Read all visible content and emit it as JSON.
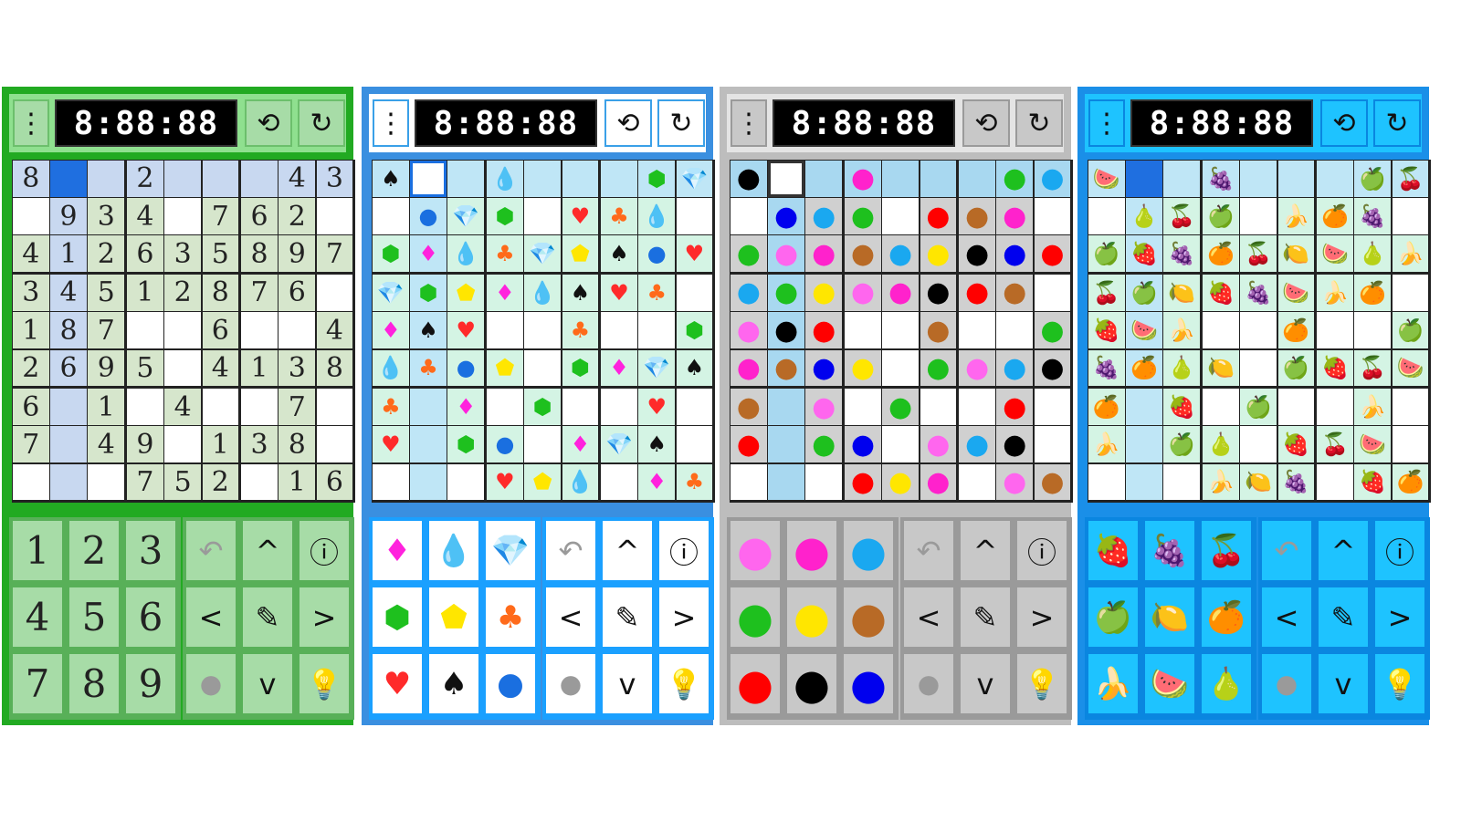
{
  "panels": [
    {
      "theme": "numbers",
      "frame": "#22aa22",
      "top_bg": "#8fe08f",
      "btn_bg": "#a7dca7",
      "btn_border": "#6cbf6c",
      "cell_bg": "#ffffff",
      "cell_tint": "#d6e6cc",
      "cell_row": "#c8d8f0",
      "cell_sel": "#1f6fe0",
      "pad_bg": "#a7dca7",
      "pad_border": "#58b058",
      "timer": "8:88:88",
      "keypad": [
        "1",
        "2",
        "3",
        "4",
        "5",
        "6",
        "7",
        "8",
        "9"
      ]
    },
    {
      "theme": "symbols",
      "frame": "#3a8fe0",
      "top_bg": "#ffffff",
      "btn_bg": "#ffffff",
      "btn_border": "#3aa0e8",
      "cell_bg": "#ffffff",
      "cell_tint": "#d4f4e4",
      "cell_row": "#bfe6f6",
      "cell_sel": "#ffffff",
      "pad_bg": "#ffffff",
      "pad_border": "#1aa0ff",
      "timer": "8:88:88",
      "keypad": [
        "♦",
        "💧",
        "💎",
        "⬢",
        "⬟",
        "♣",
        "♥",
        "♠",
        "●"
      ]
    },
    {
      "theme": "colors",
      "frame": "#bdbdbd",
      "top_bg": "#e4e4e4",
      "btn_bg": "#c8c8c8",
      "btn_border": "#9a9a9a",
      "cell_bg": "#ffffff",
      "cell_tint": "#d0d0d0",
      "cell_row": "#a8d8f0",
      "cell_sel": "#ffffff",
      "pad_bg": "#c8c8c8",
      "pad_border": "#9a9a9a",
      "timer": "8:88:88",
      "keypad": [
        "●",
        "●",
        "●",
        "●",
        "●",
        "●",
        "●",
        "●",
        "●"
      ],
      "keypad_colors": [
        "#ff66ee",
        "#ff22cc",
        "#1aa8f0",
        "#1ec01e",
        "#ffe600",
        "#b86a26",
        "#ff0000",
        "#000000",
        "#0000ee"
      ]
    },
    {
      "theme": "fruits",
      "frame": "#1a8fe8",
      "top_bg": "#1ec3ff",
      "btn_bg": "#1ec3ff",
      "btn_border": "#0a86e0",
      "cell_bg": "#ffffff",
      "cell_tint": "#d4f4e4",
      "cell_row": "#bfe6f6",
      "cell_sel": "#1f6fe0",
      "pad_bg": "#1ec3ff",
      "pad_border": "#0a86e0",
      "timer": "8:88:88",
      "keypad": [
        "🍓",
        "🍇",
        "🍒",
        "🍏",
        "🍋",
        "🍊",
        "🍌",
        "🍉",
        "🍐"
      ]
    }
  ],
  "number_grid": [
    [
      "8",
      "",
      "",
      "2",
      "",
      "",
      "",
      "4",
      "3"
    ],
    [
      "",
      "9",
      "3",
      "4",
      "",
      "7",
      "6",
      "2",
      ""
    ],
    [
      "4",
      "1",
      "2",
      "6",
      "3",
      "5",
      "8",
      "9",
      "7"
    ],
    [
      "3",
      "4",
      "5",
      "1",
      "2",
      "8",
      "7",
      "6",
      ""
    ],
    [
      "1",
      "8",
      "7",
      "",
      "",
      "6",
      "",
      "",
      "4"
    ],
    [
      "2",
      "6",
      "9",
      "5",
      "",
      "4",
      "1",
      "3",
      "8"
    ],
    [
      "6",
      "",
      "1",
      "",
      "4",
      "",
      "",
      "7",
      ""
    ],
    [
      "7",
      "",
      "4",
      "9",
      "",
      "1",
      "3",
      "8",
      ""
    ],
    [
      "",
      "",
      "",
      "7",
      "5",
      "2",
      "",
      "1",
      "6"
    ]
  ],
  "controls": {
    "undo": "↶",
    "up": "^",
    "info": "ⓘ",
    "left": "<",
    "pencil": "✎",
    "right": ">",
    "dot": "●",
    "down": "v",
    "hint": "💡"
  },
  "toolbar": {
    "menu": "⋮",
    "sync": "⟲",
    "restart": "↻"
  }
}
